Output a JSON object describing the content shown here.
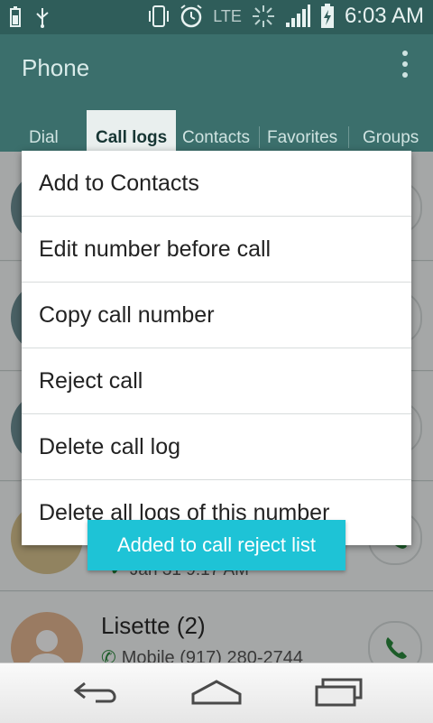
{
  "status_bar": {
    "time": "6:03 AM",
    "network": "LTE",
    "icons": [
      "battery-small-icon",
      "usb-icon",
      "vibrate-icon",
      "alarm-icon",
      "data-activity-icon",
      "signal-icon",
      "battery-charging-icon"
    ]
  },
  "app_bar": {
    "title": "Phone",
    "overflow_icon": "more-vert-icon"
  },
  "tabs": [
    {
      "label": "Dial"
    },
    {
      "label": "Call logs",
      "active": true
    },
    {
      "label": "Contacts"
    },
    {
      "label": "Favorites"
    },
    {
      "label": "Groups"
    }
  ],
  "call_log": [
    {
      "name": "Lisette  (2)",
      "sub": "Mobile (917) 280-2744",
      "sub_partial": "Jan 31 9:17 AM"
    }
  ],
  "context_menu": {
    "items": [
      {
        "label": "Add to Contacts"
      },
      {
        "label": "Edit number before call"
      },
      {
        "label": "Copy call number"
      },
      {
        "label": "Reject call"
      },
      {
        "label": "Delete call log"
      },
      {
        "label": "Delete all logs of this number"
      }
    ]
  },
  "toast": {
    "message": "Added to call reject list"
  },
  "nav_bar": {
    "icons": [
      "back-icon",
      "home-icon",
      "recents-icon"
    ]
  },
  "colors": {
    "status_bar": "#2f5d5a",
    "app_bar": "#3b6f6c",
    "toast": "#1ec3d6",
    "call_icon": "#2b8a3e"
  }
}
